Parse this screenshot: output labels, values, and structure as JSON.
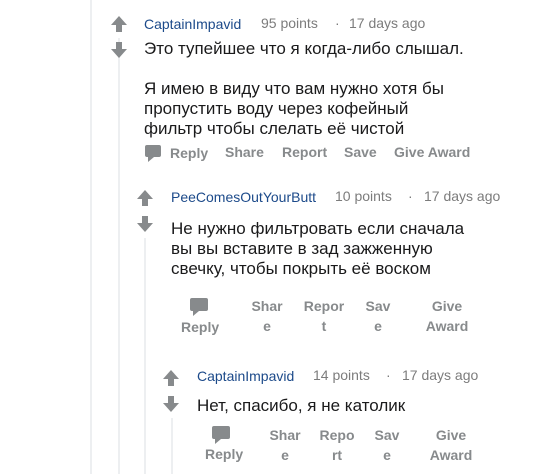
{
  "comments": [
    {
      "author": "CaptainImpavid",
      "points": "95 points",
      "separator": "·",
      "time": "17 days ago",
      "body": "Это тупейшее что я когда-либо слышал.\n\nЯ имею в виду что вам нужно хотя бы\nпропустить воду через кофейный\nфильтр чтобы слелать её чистой",
      "actions": {
        "reply": "Reply",
        "share": "Share",
        "report": "Report",
        "save": "Save",
        "award": "Give Award"
      }
    },
    {
      "author": "PeeComesOutYourButt",
      "points": "10 points",
      "separator": "·",
      "time": "17 days ago",
      "body": "Не нужно фильтровать если сначала\nвы вы вставите в зад зажженную\nсвечку, чтобы покрыть её воском",
      "actions": {
        "reply": "Reply",
        "share": "Shar\ne",
        "report": "Repor\nt",
        "save": "Sav\ne",
        "award": "Give\nAward"
      }
    },
    {
      "author": "CaptainImpavid",
      "points": "14 points",
      "separator": "·",
      "time": "17 days ago",
      "body": "Нет, спасибо, я не католик",
      "actions": {
        "reply": "Reply",
        "share": "Shar\ne",
        "report": "Repo\nrt",
        "save": "Sav\ne",
        "award": "Give\nAward"
      }
    }
  ],
  "icons": [
    "upvote-icon",
    "downvote-icon",
    "comment-bubble-icon"
  ],
  "colors": {
    "author": "#1c4a8a",
    "meta": "#7c7c7c",
    "action": "#878a8c",
    "arrow": "#878a8c",
    "thread_line": "#edeff1"
  }
}
